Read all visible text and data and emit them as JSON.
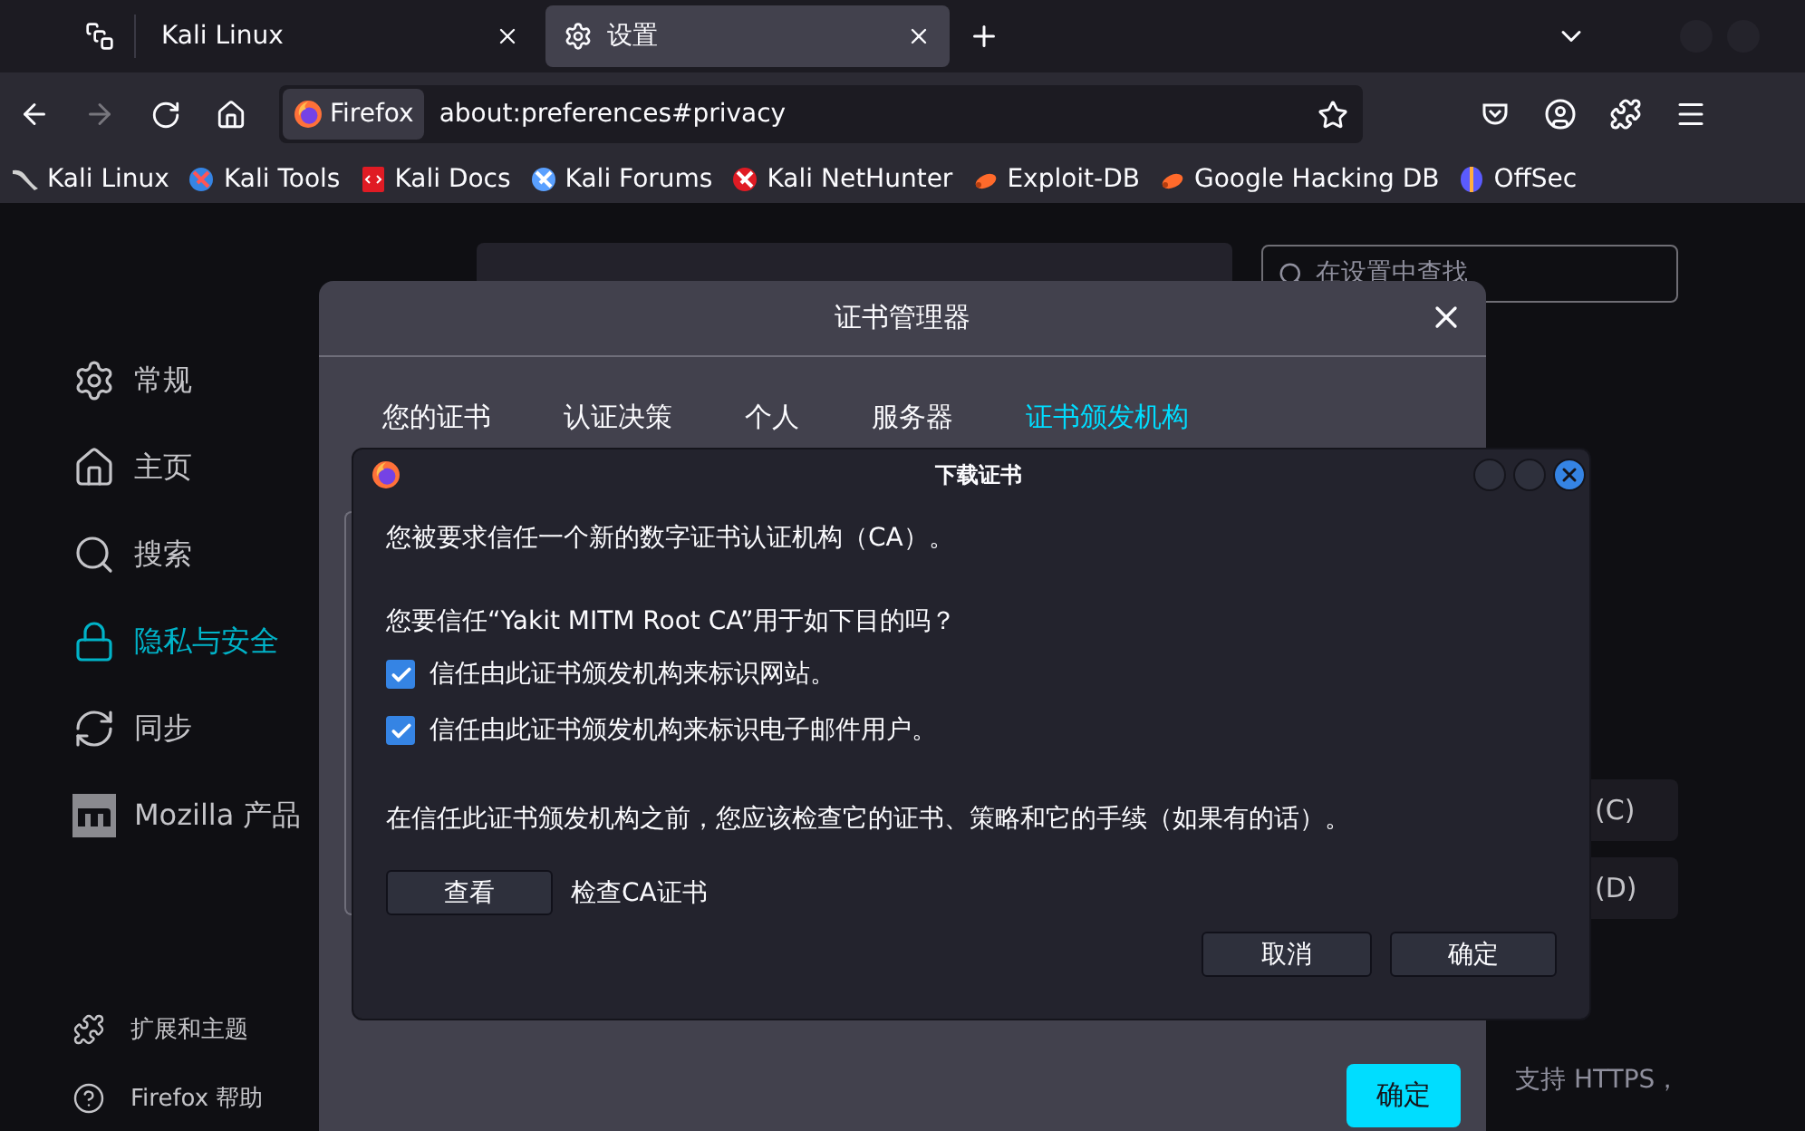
{
  "browser_tabs": [
    {
      "label": "Kali Linux",
      "selected": false,
      "kind": "page"
    },
    {
      "label": "设置",
      "selected": true,
      "kind": "settings"
    }
  ],
  "nav": {
    "back_disabled": false,
    "forward_disabled": true
  },
  "url_bar": {
    "identity": "Firefox",
    "url": "about:preferences#privacy"
  },
  "bookmarks": [
    {
      "label": "Kali Linux",
      "kind": "dragon"
    },
    {
      "label": "Kali Tools",
      "kind": "tools"
    },
    {
      "label": "Kali Docs",
      "kind": "docs"
    },
    {
      "label": "Kali Forums",
      "kind": "forums"
    },
    {
      "label": "Kali NetHunter",
      "kind": "nethunter"
    },
    {
      "label": "Exploit-DB",
      "kind": "bug"
    },
    {
      "label": "Google Hacking DB",
      "kind": "bug"
    },
    {
      "label": "OffSec",
      "kind": "offsec"
    }
  ],
  "sidebar": {
    "items": [
      {
        "label": "常规",
        "kind": "gear",
        "selected": false
      },
      {
        "label": "主页",
        "kind": "home",
        "selected": false
      },
      {
        "label": "搜索",
        "kind": "search",
        "selected": false
      },
      {
        "label": "隐私与安全",
        "kind": "lock",
        "selected": true
      },
      {
        "label": "同步",
        "kind": "sync",
        "selected": false
      },
      {
        "label": "Mozilla 产品",
        "kind": "mozilla",
        "selected": false
      }
    ],
    "footer": [
      {
        "label": "扩展和主题",
        "kind": "puzzle"
      },
      {
        "label": "Firefox 帮助",
        "kind": "help"
      }
    ]
  },
  "search": {
    "placeholder": "在设置中查找"
  },
  "page_buttons": [
    "(C)",
    "(D)"
  ],
  "page_text": "支持 HTTPS，",
  "certificate_manager": {
    "title": "证书管理器",
    "tabs": [
      {
        "label": "您的证书",
        "selected": false
      },
      {
        "label": "认证决策",
        "selected": false
      },
      {
        "label": "个人",
        "selected": false
      },
      {
        "label": "服务器",
        "selected": false
      },
      {
        "label": "证书颁发机构",
        "selected": true
      }
    ],
    "ok": "确定"
  },
  "download_dialog": {
    "title": "下载证书",
    "intro": "您被要求信任一个新的数字证书认证机构（CA）。",
    "question": "您要信任“Yakit MITM Root CA”用于如下目的吗？",
    "options": [
      {
        "label": "信任由此证书颁发机构来标识网站。",
        "checked": true
      },
      {
        "label": "信任由此证书颁发机构来标识电子邮件用户。",
        "checked": true
      }
    ],
    "advice": "在信任此证书颁发机构之前，您应该检查它的证书、策略和它的手续（如果有的话）。",
    "view_button": "查看",
    "view_label": "检查CA证书",
    "cancel": "取消",
    "ok": "确定"
  }
}
